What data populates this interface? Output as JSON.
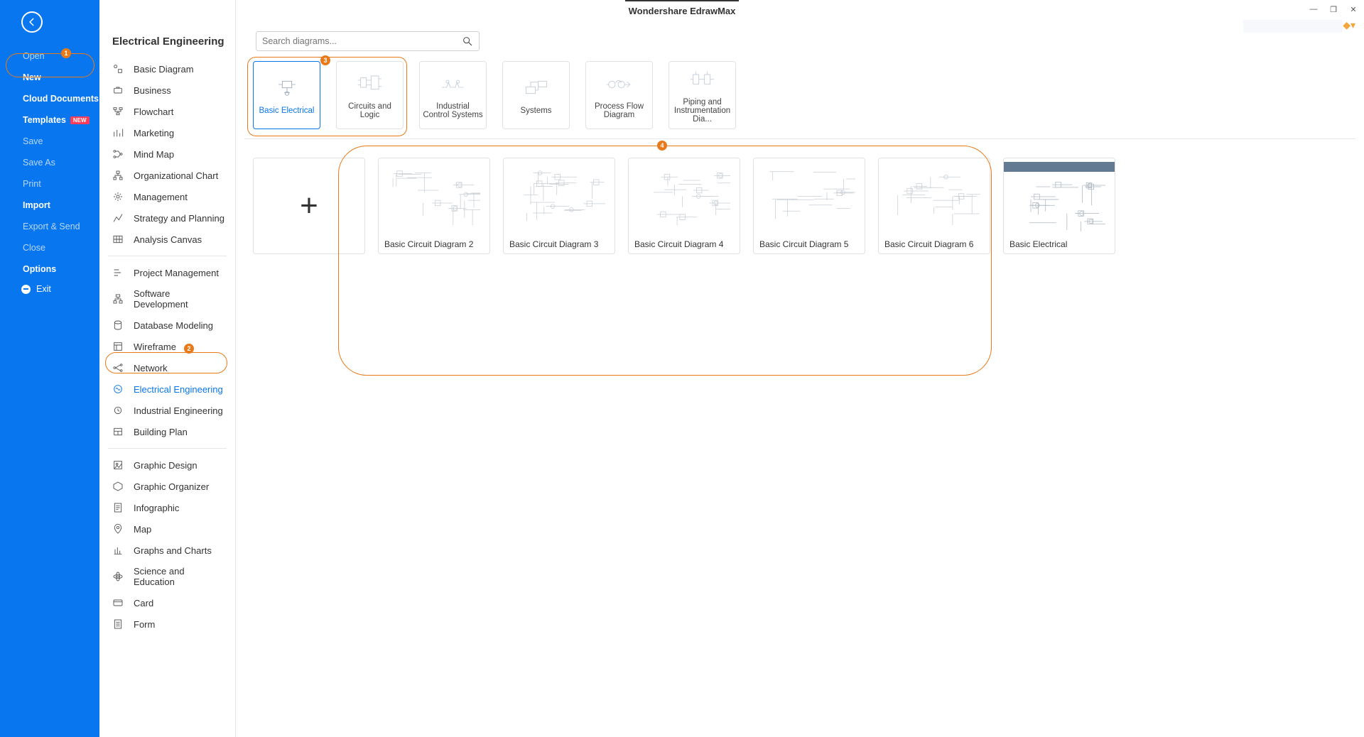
{
  "app": {
    "title": "Wondershare EdrawMax"
  },
  "win": {
    "min": "—",
    "max": "❐",
    "close": "✕"
  },
  "sidebar": {
    "items": [
      {
        "label": "Open",
        "strong": false
      },
      {
        "label": "New",
        "strong": true
      },
      {
        "label": "Cloud Documents",
        "strong": true
      },
      {
        "label": "Templates",
        "strong": true,
        "badge": "NEW"
      },
      {
        "label": "Save",
        "strong": false
      },
      {
        "label": "Save As",
        "strong": false
      },
      {
        "label": "Print",
        "strong": false
      },
      {
        "label": "Import",
        "strong": true
      },
      {
        "label": "Export & Send",
        "strong": false
      },
      {
        "label": "Close",
        "strong": false
      },
      {
        "label": "Options",
        "strong": true
      }
    ],
    "exit": "Exit"
  },
  "annotations": {
    "a1": "1",
    "a2": "2",
    "a3": "3",
    "a4": "4"
  },
  "page_title": "Electrical Engineering",
  "search": {
    "placeholder": "Search diagrams..."
  },
  "category_groups": [
    [
      {
        "name": "basic-diagram",
        "label": "Basic Diagram"
      },
      {
        "name": "business",
        "label": "Business"
      },
      {
        "name": "flowchart",
        "label": "Flowchart"
      },
      {
        "name": "marketing",
        "label": "Marketing"
      },
      {
        "name": "mind-map",
        "label": "Mind Map"
      },
      {
        "name": "org-chart",
        "label": "Organizational Chart"
      },
      {
        "name": "management",
        "label": "Management"
      },
      {
        "name": "strategy-planning",
        "label": "Strategy and Planning"
      },
      {
        "name": "analysis-canvas",
        "label": "Analysis Canvas"
      }
    ],
    [
      {
        "name": "project-mgmt",
        "label": "Project Management"
      },
      {
        "name": "software-dev",
        "label": "Software Development"
      },
      {
        "name": "database-modeling",
        "label": "Database Modeling"
      },
      {
        "name": "wireframe",
        "label": "Wireframe"
      },
      {
        "name": "network",
        "label": "Network"
      },
      {
        "name": "electrical-engineering",
        "label": "Electrical Engineering",
        "selected": true
      },
      {
        "name": "industrial-engineering",
        "label": "Industrial Engineering"
      },
      {
        "name": "building-plan",
        "label": "Building Plan"
      }
    ],
    [
      {
        "name": "graphic-design",
        "label": "Graphic Design"
      },
      {
        "name": "graphic-organizer",
        "label": "Graphic Organizer"
      },
      {
        "name": "infographic",
        "label": "Infographic"
      },
      {
        "name": "map",
        "label": "Map"
      },
      {
        "name": "graphs-charts",
        "label": "Graphs and Charts"
      },
      {
        "name": "science-education",
        "label": "Science and Education"
      },
      {
        "name": "card",
        "label": "Card"
      },
      {
        "name": "form",
        "label": "Form"
      }
    ]
  ],
  "subcats": [
    {
      "name": "basic-electrical",
      "label": "Basic Electrical",
      "selected": true
    },
    {
      "name": "circuits-and-logic",
      "label": "Circuits and Logic"
    },
    {
      "name": "industrial-control-systems",
      "label": "Industrial Control Systems"
    },
    {
      "name": "systems",
      "label": "Systems"
    },
    {
      "name": "process-flow-diagram",
      "label": "Process Flow Diagram"
    },
    {
      "name": "piping-instrumentation",
      "label": "Piping and Instrumentation Dia..."
    }
  ],
  "templates": [
    {
      "name": "blank",
      "label": "",
      "blank": true
    },
    {
      "name": "basic-circuit-2",
      "label": "Basic Circuit Diagram 2"
    },
    {
      "name": "basic-circuit-3",
      "label": "Basic Circuit Diagram 3"
    },
    {
      "name": "basic-circuit-4",
      "label": "Basic Circuit Diagram 4"
    },
    {
      "name": "basic-circuit-5",
      "label": "Basic Circuit Diagram 5"
    },
    {
      "name": "basic-circuit-6",
      "label": "Basic Circuit Diagram 6"
    },
    {
      "name": "basic-electrical-tpl",
      "label": "Basic Electrical",
      "has_header_bar": true
    }
  ]
}
